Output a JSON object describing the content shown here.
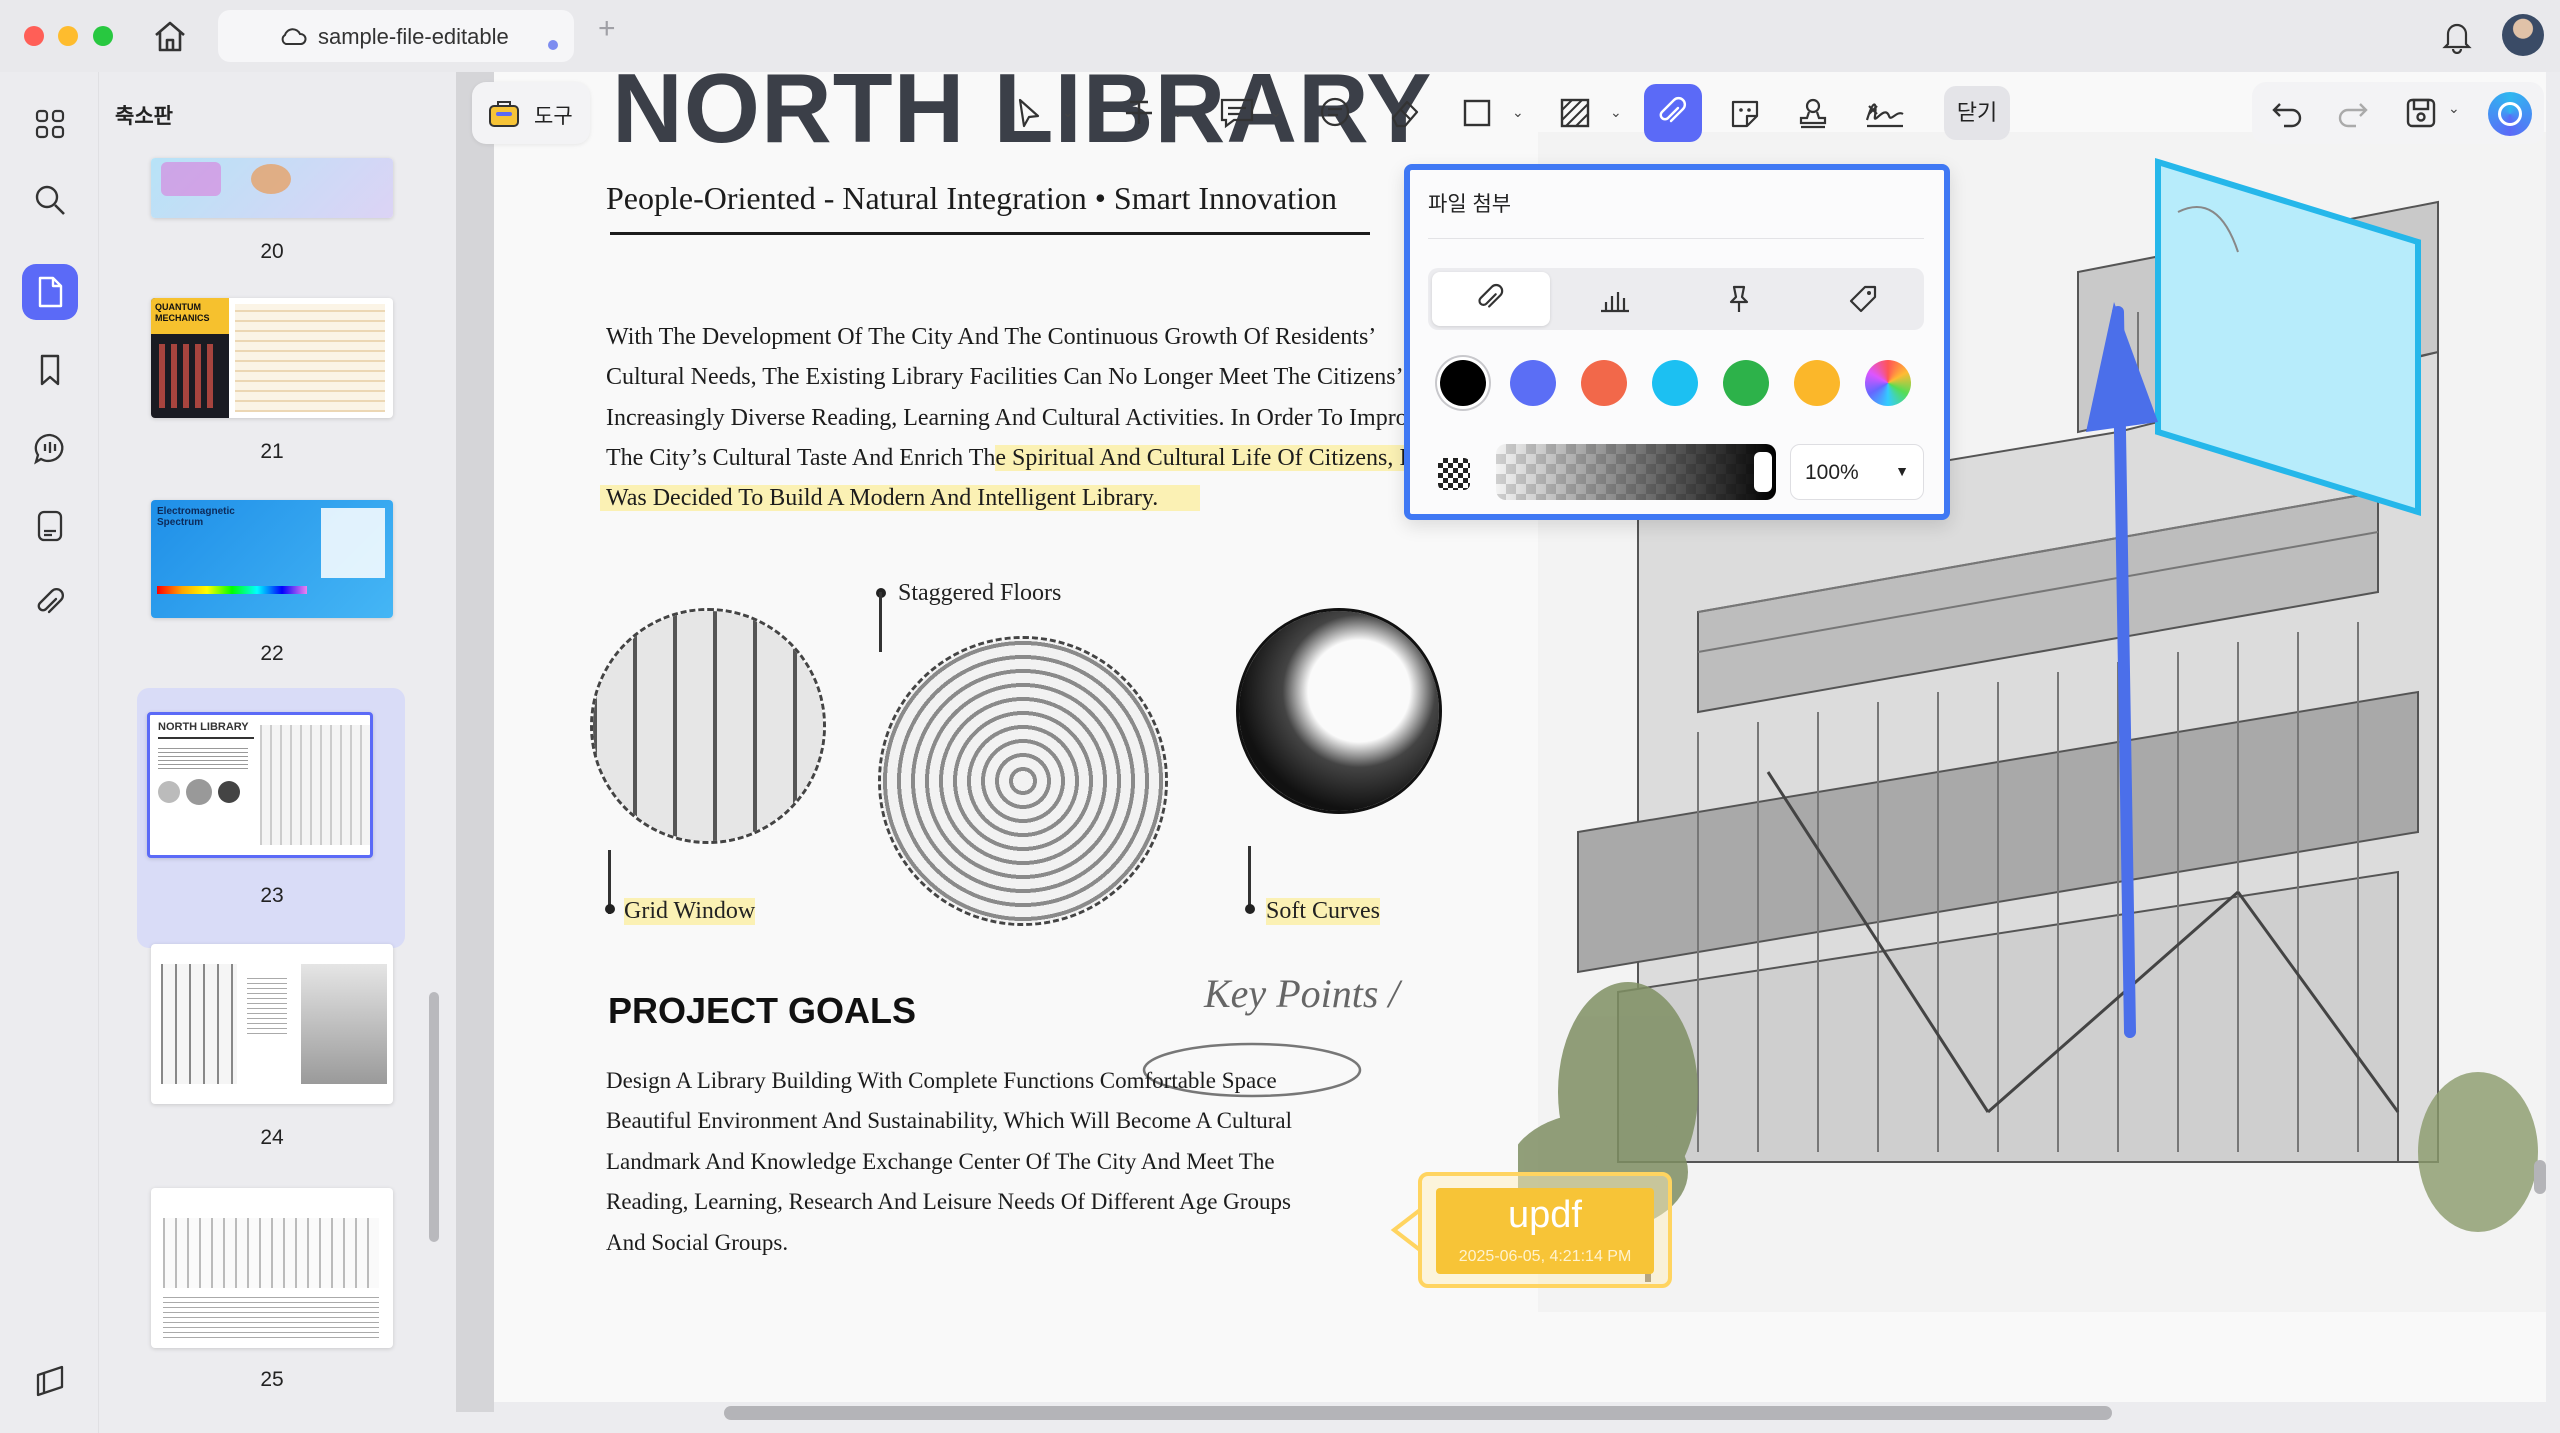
{
  "window": {
    "tab_title": "sample-file-editable",
    "new_tab": "+"
  },
  "sidebar": {
    "panel_title": "축소판",
    "rail_icons": [
      "grid-icon",
      "search-icon",
      "pages-icon",
      "bookmark-icon",
      "comment-icon",
      "form-icon",
      "attachment-icon",
      "layers-icon"
    ],
    "thumbnails": [
      {
        "page": "20"
      },
      {
        "page": "21",
        "text": "QUANTUM MECHANICS"
      },
      {
        "page": "22",
        "text": "Electromagnetic Spectrum"
      },
      {
        "page": "23",
        "text": "NORTH LIBRARY"
      },
      {
        "page": "24"
      },
      {
        "page": "25"
      }
    ]
  },
  "toolbar": {
    "tools_label": "도구",
    "close_label": "닫기",
    "icons": [
      "select-icon",
      "strikethrough-icon",
      "comment-icon",
      "text-box-icon",
      "eraser-icon",
      "rectangle-icon",
      "hatch-icon",
      "attachment-icon",
      "sticker-icon",
      "stamp-icon",
      "signature-icon"
    ]
  },
  "popover": {
    "title": "파일 첨부",
    "icon_tabs": [
      "paperclip-icon",
      "graph-icon",
      "pushpin-icon",
      "tag-icon"
    ],
    "colors": [
      "#000000",
      "#5b6ef5",
      "#f2684a",
      "#1cc0f2",
      "#2db24a",
      "#fbb72a",
      "rainbow"
    ],
    "selected_color": "#000000",
    "opacity": "100%",
    "opacity_level": 1.0
  },
  "document": {
    "heading": "NORTH LIBRARY",
    "subtitle": "People-Oriented - Natural Integration • Smart Innovation",
    "paragraph_lines": [
      "With The Development Of The City And The Continuous Growth Of Residents’",
      "Cultural Needs, The Existing Library Facilities Can No Longer Meet The Citizens’",
      "Increasingly Diverse Reading, Learning And Cultural Activities. In Order To Impro",
      "The City’s Cultural Taste And Enrich Th",
      "e Spiritual And Cultural Life Of Citizens, I",
      "Was Decided To Build A Modern And Intelligent Library."
    ],
    "callouts": {
      "staggered": "Staggered Floors",
      "grid": "Grid Window",
      "soft": "Soft Curves"
    },
    "goals_title": "PROJECT GOALS",
    "key_points": "Key Points /",
    "goal_lines": [
      "Design A Library Building With Complete Functions Comfortable Space",
      "Beautiful Environment And Sustainability, Which Will Become A Cultural",
      "Landmark And Knowledge Exchange Center Of The City And Meet The",
      "Reading, Learning, Research And Leisure Needs Of Different Age Groups",
      "And Social Groups."
    ],
    "stamp": {
      "title": "updf",
      "timestamp": "2025-06-05, 4:21:14 PM"
    }
  }
}
